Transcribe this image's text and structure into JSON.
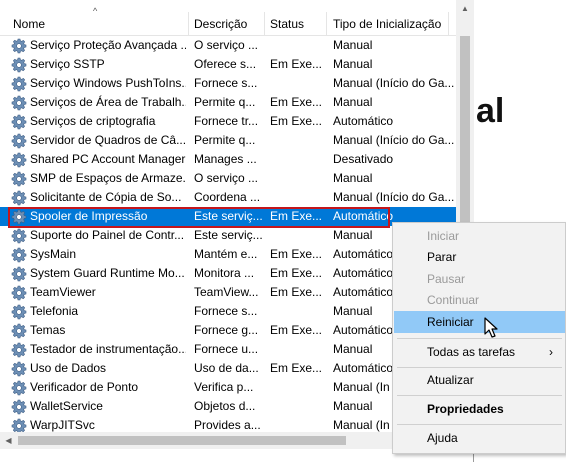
{
  "background_heading": "al",
  "columns": {
    "name": "Nome",
    "description": "Descrição",
    "status": "Status",
    "startup": "Tipo de Inicialização"
  },
  "services": [
    {
      "name": "Serviço Proteção Avançada ...",
      "desc": "O serviço ...",
      "status": "",
      "startup": "Manual"
    },
    {
      "name": "Serviço SSTP",
      "desc": "Oferece s...",
      "status": "Em Exe...",
      "startup": "Manual"
    },
    {
      "name": "Serviço Windows PushToIns...",
      "desc": "Fornece s...",
      "status": "",
      "startup": "Manual (Início do Ga..."
    },
    {
      "name": "Serviços de Área de Trabalh...",
      "desc": "Permite q...",
      "status": "Em Exe...",
      "startup": "Manual"
    },
    {
      "name": "Serviços de criptografia",
      "desc": "Fornece tr...",
      "status": "Em Exe...",
      "startup": "Automático"
    },
    {
      "name": "Servidor de Quadros de Câ...",
      "desc": "Permite q...",
      "status": "",
      "startup": "Manual (Início do Ga..."
    },
    {
      "name": "Shared PC Account Manager",
      "desc": "Manages ...",
      "status": "",
      "startup": "Desativado"
    },
    {
      "name": "SMP de Espaços de Armaze...",
      "desc": "O serviço ...",
      "status": "",
      "startup": "Manual"
    },
    {
      "name": "Solicitante de Cópia de So...",
      "desc": "Coordena ...",
      "status": "",
      "startup": "Manual (Início do Ga..."
    },
    {
      "name": "Spooler de Impressão",
      "desc": "Este serviç...",
      "status": "Em Exe...",
      "startup": "Automático"
    },
    {
      "name": "Suporte do Painel de Contr...",
      "desc": "Este serviç...",
      "status": "",
      "startup": "Manual"
    },
    {
      "name": "SysMain",
      "desc": "Mantém e...",
      "status": "Em Exe...",
      "startup": "Automático"
    },
    {
      "name": "System Guard Runtime Mo...",
      "desc": "Monitora ...",
      "status": "Em Exe...",
      "startup": "Automático"
    },
    {
      "name": "TeamViewer",
      "desc": "TeamView...",
      "status": "Em Exe...",
      "startup": "Automático"
    },
    {
      "name": "Telefonia",
      "desc": "Fornece s...",
      "status": "",
      "startup": "Manual"
    },
    {
      "name": "Temas",
      "desc": "Fornece g...",
      "status": "Em Exe...",
      "startup": "Automático"
    },
    {
      "name": "Testador de instrumentação...",
      "desc": "Fornece u...",
      "status": "",
      "startup": "Manual"
    },
    {
      "name": "Uso de Dados",
      "desc": "Uso de da...",
      "status": "Em Exe...",
      "startup": "Automático"
    },
    {
      "name": "Verificador de Ponto",
      "desc": "Verifica p...",
      "status": "",
      "startup": "Manual (In"
    },
    {
      "name": "WalletService",
      "desc": "Objetos d...",
      "status": "",
      "startup": "Manual"
    },
    {
      "name": "WarpJITSvc",
      "desc": "Provides a...",
      "status": "",
      "startup": "Manual (In"
    }
  ],
  "selected_service": "Spooler de Impressão",
  "context_menu": {
    "start": "Iniciar",
    "stop": "Parar",
    "pause": "Pausar",
    "resume": "Continuar",
    "restart": "Reiniciar",
    "all_tasks": "Todas as tarefas",
    "refresh": "Atualizar",
    "properties": "Propriedades",
    "help": "Ajuda"
  },
  "colors": {
    "selection": "#0078d7",
    "menu_hover": "#91c9f7",
    "highlight_border": "#c4161c"
  },
  "icons": {
    "service": "gear-icon",
    "sort": "sort-ascending-icon",
    "submenu": "chevron-right-icon",
    "cursor": "mouse-pointer-icon"
  }
}
